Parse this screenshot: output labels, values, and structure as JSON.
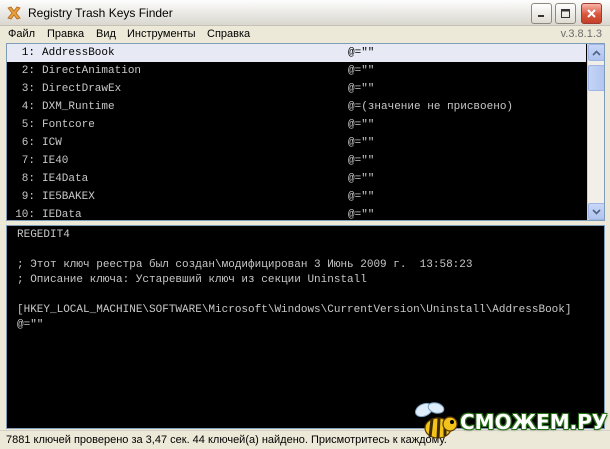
{
  "window": {
    "title": "Registry Trash Keys Finder",
    "icon": "red-cross-icon"
  },
  "menu": {
    "items": [
      "Файл",
      "Правка",
      "Вид",
      "Инструменты",
      "Справка"
    ],
    "version": "v.3.8.1.3"
  },
  "keys": [
    {
      "num": "1:",
      "name": "AddressBook",
      "value": "@=\"\""
    },
    {
      "num": "2:",
      "name": "DirectAnimation",
      "value": "@=\"\""
    },
    {
      "num": "3:",
      "name": "DirectDrawEx",
      "value": "@=\"\""
    },
    {
      "num": "4:",
      "name": "DXM_Runtime",
      "value": "@=(значение не присвоено)"
    },
    {
      "num": "5:",
      "name": "Fontcore",
      "value": "@=\"\""
    },
    {
      "num": "6:",
      "name": "ICW",
      "value": "@=\"\""
    },
    {
      "num": "7:",
      "name": "IE40",
      "value": "@=\"\""
    },
    {
      "num": "8:",
      "name": "IE4Data",
      "value": "@=\"\""
    },
    {
      "num": "9:",
      "name": "IE5BAKEX",
      "value": "@=\"\""
    },
    {
      "num": "10:",
      "name": "IEData",
      "value": "@=\"\""
    }
  ],
  "selected_index": 0,
  "details": {
    "lines": [
      "REGEDIT4",
      "",
      "; Этот ключ реестра был создан\\модифицирован 3 Июнь 2009 г.  13:58:23",
      "; Описание ключа: Устаревший ключ из секции Uninstall",
      "",
      "[HKEY_LOCAL_MACHINE\\SOFTWARE\\Microsoft\\Windows\\CurrentVersion\\Uninstall\\AddressBook]",
      "@=\"\""
    ]
  },
  "status": {
    "text": "7881 ключей проверено за 3,47 сек. 44 ключей(а) найдено. Присмотритесь к каждому."
  },
  "watermark": {
    "text": "СМОЖЕМ.РУ"
  }
}
